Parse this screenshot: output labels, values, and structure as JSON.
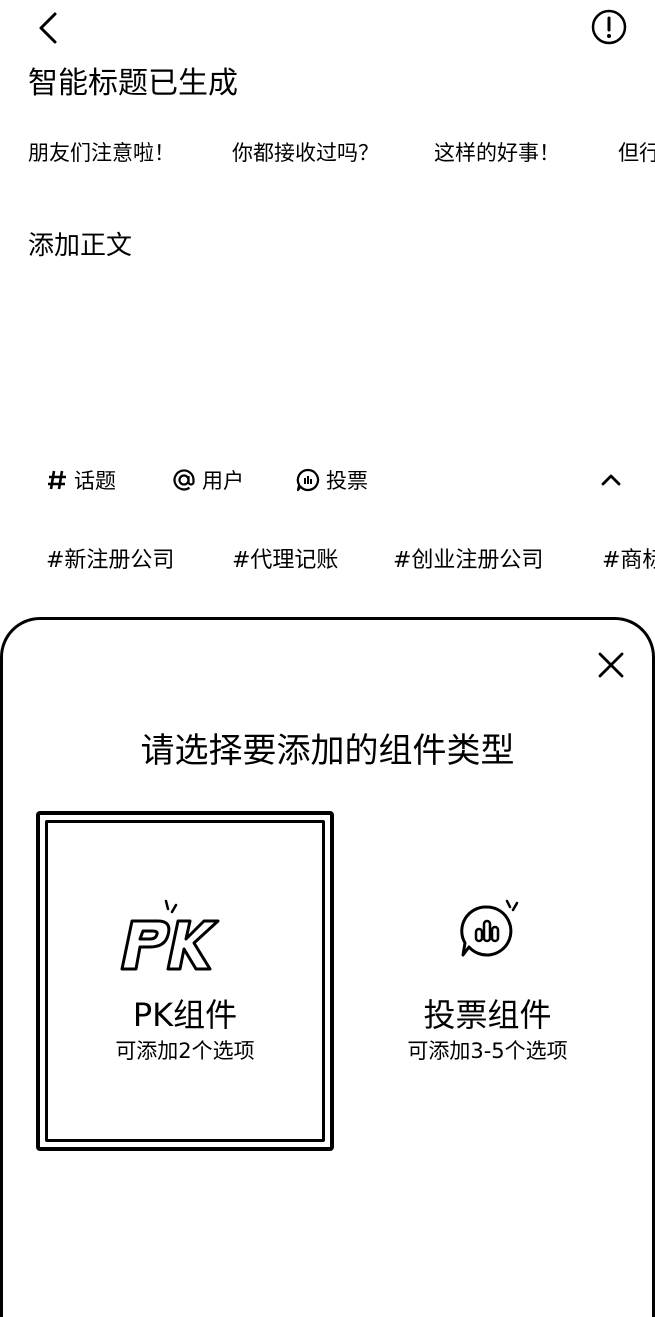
{
  "header": {
    "smart_title_banner": "智能标题已生成"
  },
  "suggestions": [
    "朋友们注意啦！",
    "你都接收过吗？",
    "这样的好事！",
    "但行"
  ],
  "editor": {
    "body_placeholder": "添加正文"
  },
  "toolbar": {
    "topic_label": "话题",
    "user_label": "用户",
    "vote_label": "投票"
  },
  "hashtags": [
    "#新注册公司",
    "#代理记账",
    "#创业注册公司",
    "#商标"
  ],
  "sheet": {
    "title": "请选择要添加的组件类型",
    "cards": [
      {
        "title": "PK组件",
        "subtitle": "可添加2个选项",
        "icon": "pk-icon",
        "selected": true
      },
      {
        "title": "投票组件",
        "subtitle": "可添加3-5个选项",
        "icon": "vote-bubble-icon",
        "selected": false
      }
    ]
  },
  "icons": {
    "back": "chevron-left-icon",
    "info": "exclamation-circle-icon",
    "topic": "hash-icon",
    "user": "at-icon",
    "vote": "vote-icon",
    "collapse": "chevron-up-icon",
    "close": "close-icon"
  }
}
